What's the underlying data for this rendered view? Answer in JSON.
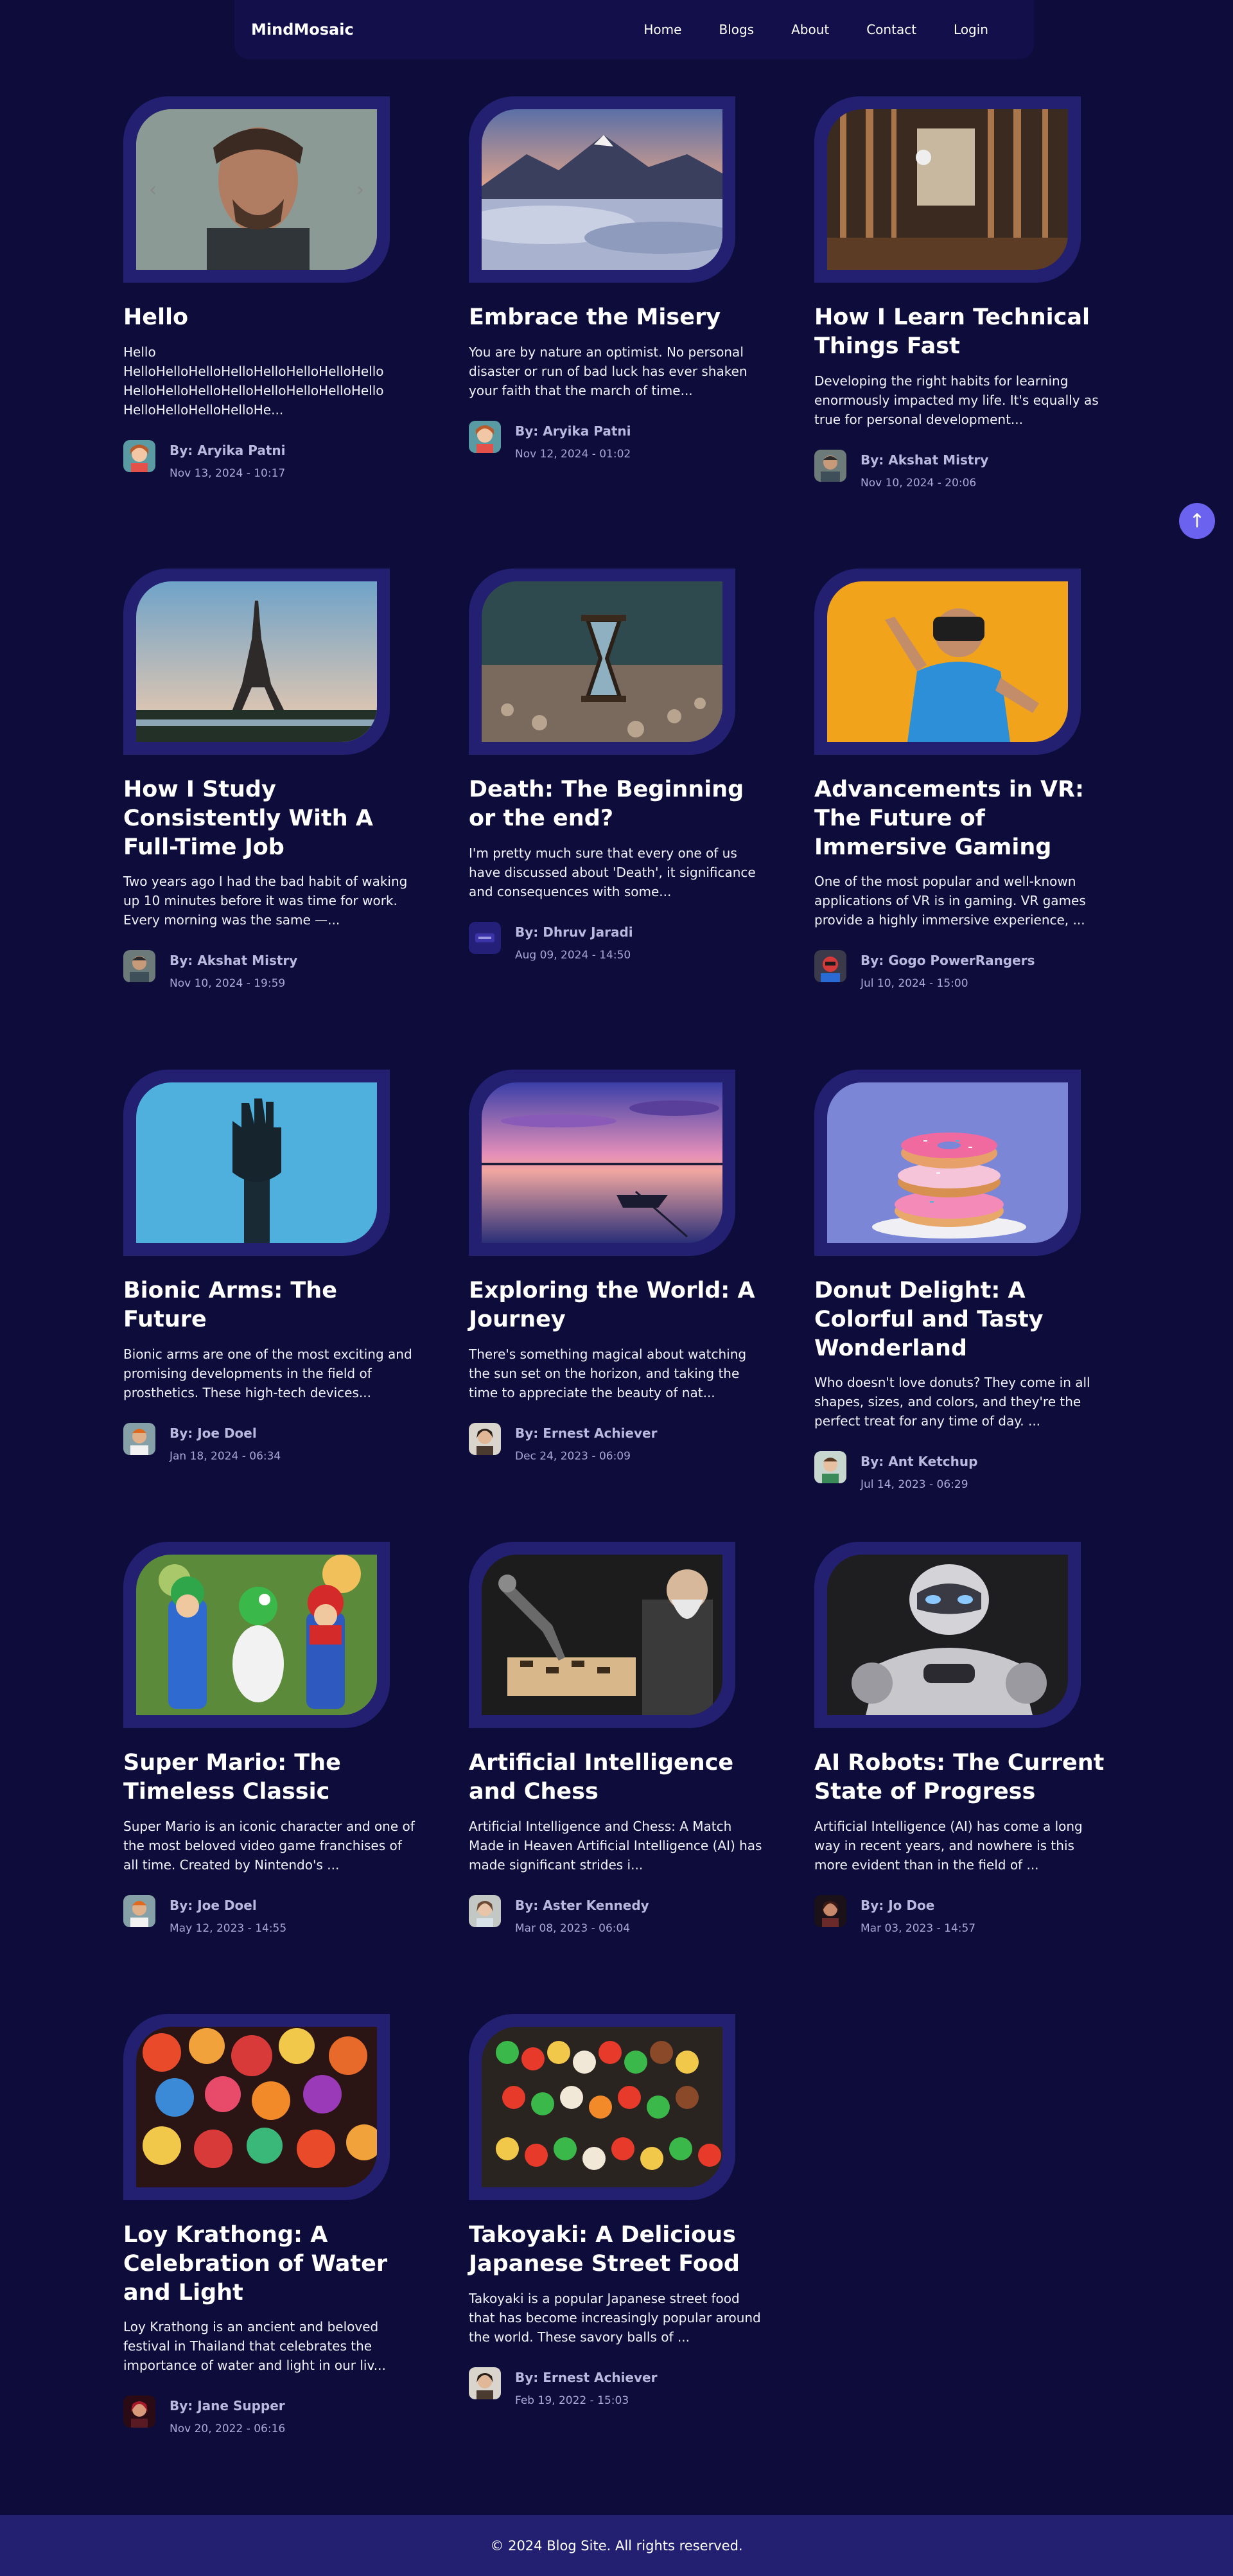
{
  "nav": {
    "brand": "MindMosaic",
    "links": [
      "Home",
      "Blogs",
      "About",
      "Contact",
      "Login"
    ]
  },
  "posts": [
    {
      "title": "Hello",
      "excerpt": "Hello HelloHelloHelloHelloHelloHelloHelloHello HelloHelloHelloHelloHelloHelloHelloHello HelloHelloHelloHelloHe...",
      "author": "By: Aryika Patni",
      "date": "Nov 13, 2024 - 10:17",
      "image_icon": "portrait-man-photo",
      "avatar_icon": "avatar-girl"
    },
    {
      "title": "Embrace the Misery",
      "excerpt": "You are by nature an optimist. No personal disaster or run of bad luck has ever shaken your faith that the march of time...",
      "author": "By: Aryika Patni",
      "date": "Nov 12, 2024 - 01:02",
      "image_icon": "mountain-photo",
      "avatar_icon": "avatar-girl"
    },
    {
      "title": "How I Learn Technical Things Fast",
      "excerpt": "Developing the right habits for learning enormously impacted my life. It's equally as true for personal development...",
      "author": "By: Akshat Mistry",
      "date": "Nov 10, 2024 - 20:06",
      "image_icon": "abstract-room-photo",
      "avatar_icon": "avatar-man"
    },
    {
      "title": "How I Study Consistently With A Full-Time Job",
      "excerpt": "Two years ago I had the bad habit of waking up 10 minutes before it was time for work. Every morning was the same —...",
      "author": "By: Akshat Mistry",
      "date": "Nov 10, 2024 - 19:59",
      "image_icon": "eiffel-tower-photo",
      "avatar_icon": "avatar-man"
    },
    {
      "title": "Death: The Beginning or the end?",
      "excerpt": "I'm pretty much sure that every one of us have discussed about 'Death', it significance and consequences with some...",
      "author": "By: Dhruv Jaradi",
      "date": "Aug 09, 2024 - 14:50",
      "image_icon": "hourglass-photo",
      "avatar_icon": "avatar-logo"
    },
    {
      "title": "Advancements in VR: The Future of Immersive Gaming",
      "excerpt": "One of the most popular and well-known applications of VR is in gaming. VR games provide a highly immersive experience, ...",
      "author": "By: Gogo PowerRangers",
      "date": "Jul 10, 2024 - 15:00",
      "image_icon": "vr-boy-photo",
      "avatar_icon": "avatar-ranger"
    },
    {
      "title": "Bionic Arms: The Future",
      "excerpt": "Bionic arms are one of the most exciting and promising developments in the field of prosthetics. These high-tech devices...",
      "author": "By: Joe Doel",
      "date": "Jan 18, 2024 - 06:34",
      "image_icon": "bionic-hand-photo",
      "avatar_icon": "avatar-orange"
    },
    {
      "title": "Exploring the World: A Journey",
      "excerpt": "There's something magical about watching the sun set on the horizon, and taking the time to appreciate the beauty of nat...",
      "author": "By: Ernest Achiever",
      "date": "Dec 24, 2023 - 06:09",
      "image_icon": "sunset-boat-photo",
      "avatar_icon": "avatar-woman"
    },
    {
      "title": "Donut Delight: A Colorful and Tasty Wonderland",
      "excerpt": "Who doesn't love donuts? They come in all shapes, sizes, and colors, and they're the perfect treat for any time of day. ...",
      "author": "By: Ant Ketchup",
      "date": "Jul 14, 2023 - 06:29",
      "image_icon": "donuts-photo",
      "avatar_icon": "avatar-boy"
    },
    {
      "title": "Super Mario: The Timeless Classic",
      "excerpt": "Super Mario is an iconic character and one of the most beloved video game franchises of all time. Created by Nintendo's ...",
      "author": "By: Joe Doel",
      "date": "May 12, 2023 - 14:55",
      "image_icon": "mario-toys-photo",
      "avatar_icon": "avatar-orange"
    },
    {
      "title": "Artificial Intelligence and Chess",
      "excerpt": "Artificial Intelligence and Chess: A Match Made in Heaven Artificial Intelligence (AI) has made significant strides i...",
      "author": "By: Aster Kennedy",
      "date": "Mar 08, 2023 - 06:04",
      "image_icon": "robot-chess-photo",
      "avatar_icon": "avatar-woman-2"
    },
    {
      "title": "AI Robots: The Current State of Progress",
      "excerpt": "Artificial Intelligence (AI) has come a long way in recent years, and nowhere is this more evident than in the field of ...",
      "author": "By: Jo Doe",
      "date": "Mar 03, 2023 - 14:57",
      "image_icon": "robot-photo",
      "avatar_icon": "avatar-dark"
    },
    {
      "title": "Loy Krathong: A Celebration of Water and Light",
      "excerpt": "Loy Krathong is an ancient and beloved festival in Thailand that celebrates the importance of water and light in our liv...",
      "author": "By: Jane Supper",
      "date": "Nov 20, 2022 - 06:16",
      "image_icon": "lanterns-photo",
      "avatar_icon": "avatar-red"
    },
    {
      "title": "Takoyaki: A Delicious Japanese Street Food",
      "excerpt": "Takoyaki is a popular Japanese street food that has become increasingly popular around the world. These savory balls of ...",
      "author": "By: Ernest Achiever",
      "date": "Feb 19, 2022 - 15:03",
      "image_icon": "skewers-photo",
      "avatar_icon": "avatar-woman"
    }
  ],
  "scroll_top_icon": "arrow-up-icon",
  "scroll_top_glyph": "↑",
  "footer": "© 2024 Blog Site. All rights reserved.",
  "colors": {
    "background": "#0d0c3a",
    "frame": "#232072",
    "accent": "#6b63f0",
    "footer": "#232072"
  }
}
